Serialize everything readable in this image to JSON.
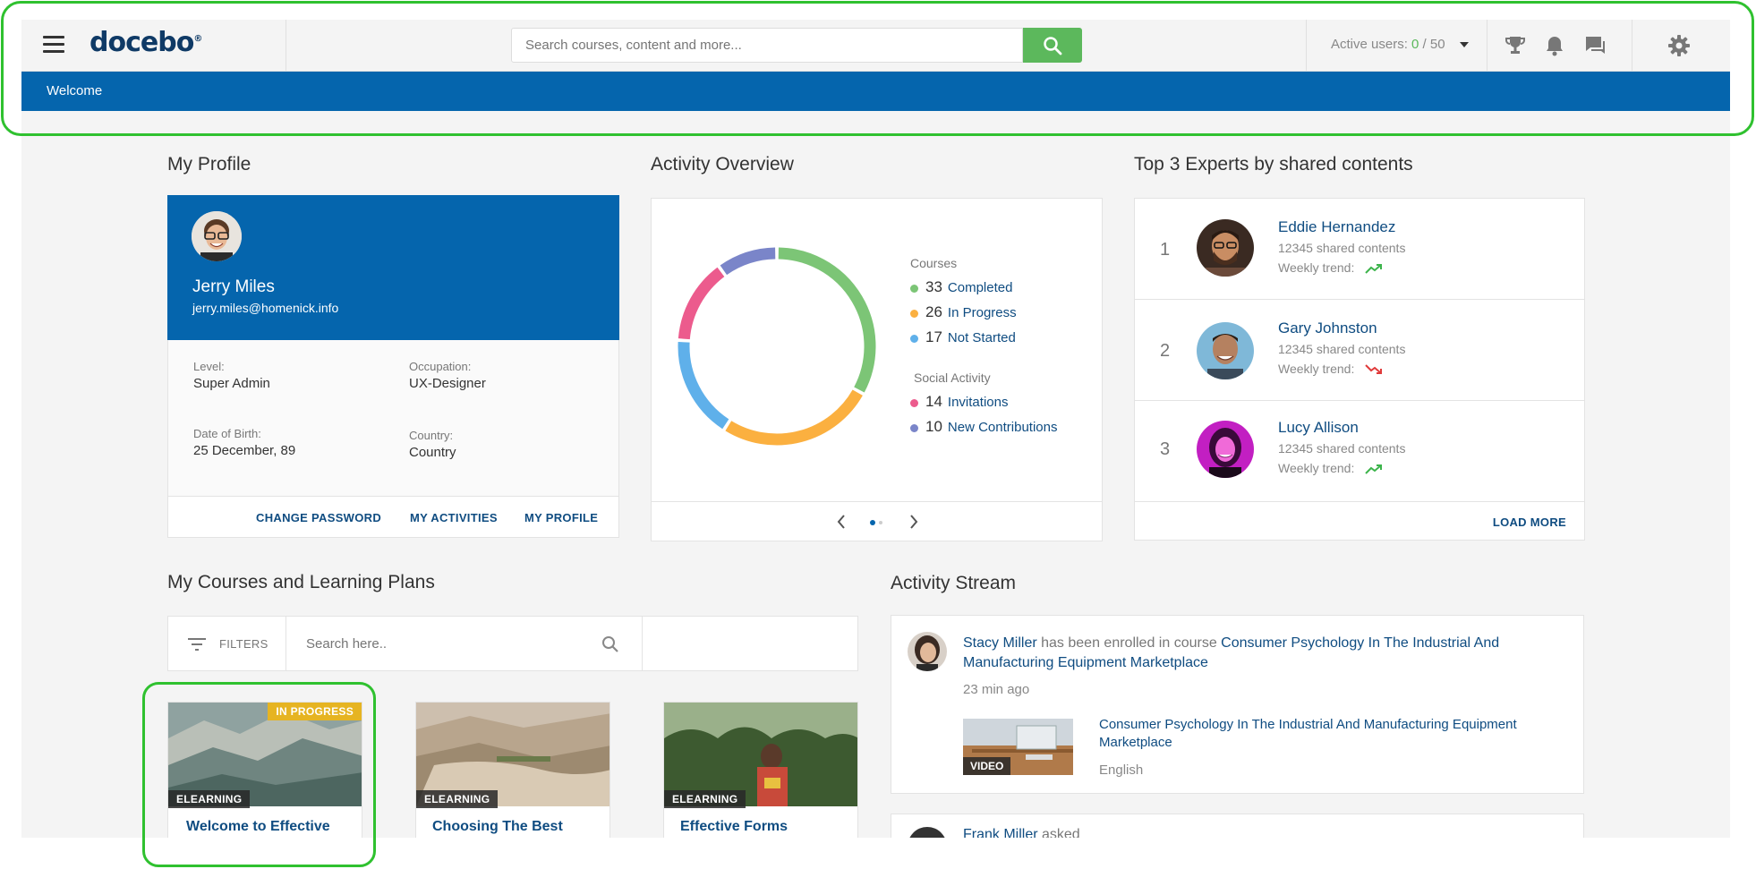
{
  "header": {
    "logo": "docebo",
    "search_placeholder": "Search courses, content and more...",
    "active_users_label": "Active users:",
    "active_users_current": "0",
    "active_users_sep": " / ",
    "active_users_max": "50"
  },
  "nav": {
    "welcome": "Welcome"
  },
  "profile": {
    "section_title": "My Profile",
    "name": "Jerry Miles",
    "email": "jerry.miles@homenick.info",
    "level_label": "Level:",
    "level_value": "Super Admin",
    "occupation_label": "Occupation:",
    "occupation_value": "UX-Designer",
    "dob_label": "Date of Birth:",
    "dob_value": "25 December, 89",
    "country_label": "Country:",
    "country_value": "Country",
    "links": [
      "CHANGE PASSWORD",
      "MY ACTIVITIES",
      "MY PROFILE"
    ]
  },
  "activity": {
    "section_title": "Activity Overview",
    "courses_head": "Courses",
    "social_head": "Social Activity",
    "items": [
      {
        "value": 33,
        "label": "Completed",
        "color": "#7cc576"
      },
      {
        "value": 26,
        "label": "In Progress",
        "color": "#fbb040"
      },
      {
        "value": 17,
        "label": "Not Started",
        "color": "#5fb0ea"
      },
      {
        "value": 14,
        "label": "Invitations",
        "color": "#ec5b8d"
      },
      {
        "value": 10,
        "label": "New Contributions",
        "color": "#7a85c9"
      }
    ]
  },
  "experts": {
    "section_title": "Top 3 Experts by shared contents",
    "trend_label": "Weekly trend:",
    "load_more": "LOAD MORE",
    "list": [
      {
        "rank": "1",
        "name": "Eddie Hernandez",
        "count": "12345 shared contents",
        "trend": "up"
      },
      {
        "rank": "2",
        "name": "Gary Johnston",
        "count": "12345 shared contents",
        "trend": "down"
      },
      {
        "rank": "3",
        "name": "Lucy Allison",
        "count": "12345 shared contents",
        "trend": "up"
      }
    ]
  },
  "courses": {
    "section_title": "My Courses and Learning Plans",
    "filters_label": "FILTERS",
    "search_placeholder": "Search here..",
    "cards": [
      {
        "type": "ELEARNING",
        "badge": "IN PROGRESS",
        "title": "Welcome to Effective"
      },
      {
        "type": "ELEARNING",
        "badge": "",
        "title": "Choosing The Best"
      },
      {
        "type": "ELEARNING",
        "badge": "",
        "title": "Effective Forms"
      }
    ]
  },
  "stream": {
    "section_title": "Activity Stream",
    "user": "Stacy Miller",
    "action": " has been enrolled in course ",
    "course_line1": "Consumer Psychology In The Industrial And",
    "course_line2": "Manufacturing Equipment Marketplace",
    "time": "23 min ago",
    "content_title_line1": "Consumer Psychology In The Industrial And Manufacturing Equipment",
    "content_title_line2": "Marketplace",
    "content_type": "VIDEO",
    "content_lang": "English",
    "next_user": "Frank Miller",
    "next_action": " asked"
  }
}
